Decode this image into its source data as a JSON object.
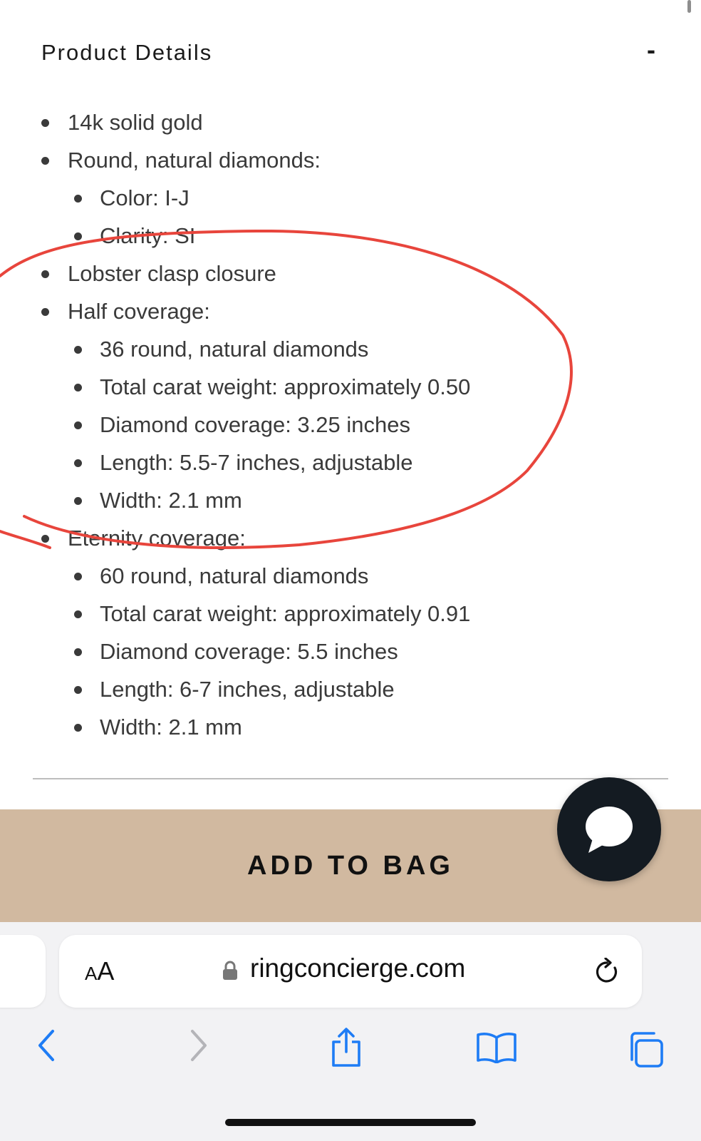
{
  "product_details": {
    "title": "Product Details",
    "toggle": "-",
    "items": [
      {
        "level": 1,
        "text": "14k solid gold"
      },
      {
        "level": 1,
        "text": "Round, natural diamonds:"
      },
      {
        "level": 2,
        "text": "Color: I-J"
      },
      {
        "level": 2,
        "text": "Clarity: SI"
      },
      {
        "level": 1,
        "text": "Lobster clasp closure"
      },
      {
        "level": 1,
        "text": "Half coverage:"
      },
      {
        "level": 2,
        "text": "36 round, natural diamonds"
      },
      {
        "level": 2,
        "text": "Total carat weight: approximately 0.50"
      },
      {
        "level": 2,
        "text": "Diamond coverage: 3.25 inches"
      },
      {
        "level": 2,
        "text": "Length: 5.5-7 inches, adjustable"
      },
      {
        "level": 2,
        "text": "Width: 2.1 mm"
      },
      {
        "level": 1,
        "text": "Eternity coverage:"
      },
      {
        "level": 2,
        "text": "60 round, natural diamonds"
      },
      {
        "level": 2,
        "text": "Total carat weight: approximately 0.91"
      },
      {
        "level": 2,
        "text": "Diamond coverage: 5.5 inches"
      },
      {
        "level": 2,
        "text": "Length: 6-7 inches, adjustable"
      },
      {
        "level": 2,
        "text": "Width: 2.1 mm"
      }
    ]
  },
  "add_to_bag": {
    "label": "ADD TO BAG",
    "color": "#d1b9a0"
  },
  "chat": {
    "icon": "chat-bubble-icon"
  },
  "browser": {
    "text_size_small": "A",
    "text_size_big": "A",
    "url": "ringconcierge.com",
    "icons": [
      "lock-icon",
      "reload-icon",
      "back-icon",
      "forward-icon",
      "share-icon",
      "bookmarks-icon",
      "tabs-icon"
    ],
    "accent": "#1e7cf5"
  },
  "annotation": {
    "color": "#e8453c",
    "shape": "hand-drawn circle"
  }
}
